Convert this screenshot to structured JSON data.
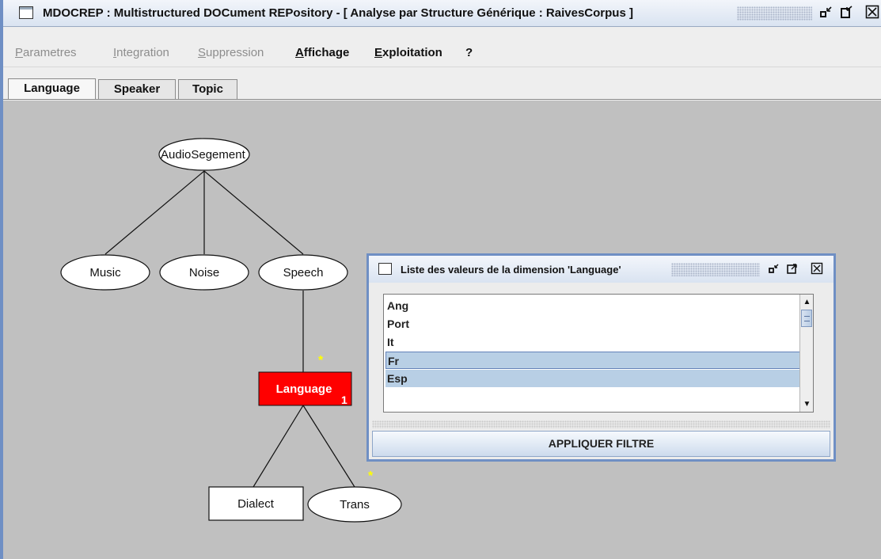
{
  "window": {
    "title": "MDOCREP : Multistructured DOCument REPository - [ Analyse par Structure Générique : RaivesCorpus ]",
    "minimize_icon": "minimize-icon",
    "maximize_icon": "maximize-icon",
    "close_icon": "close-icon"
  },
  "menu": {
    "items": [
      {
        "label": "Parametres",
        "mnemonic": "P",
        "rest": "arametres",
        "enabled": false
      },
      {
        "label": "Integration",
        "mnemonic": "I",
        "rest": "ntegration",
        "enabled": false
      },
      {
        "label": "Suppression",
        "mnemonic": "S",
        "rest": "uppression",
        "enabled": false
      },
      {
        "label": "Affichage",
        "mnemonic": "A",
        "rest": "ffichage",
        "enabled": true
      },
      {
        "label": "Exploitation",
        "mnemonic": "E",
        "rest": "xploitation",
        "enabled": true
      },
      {
        "label": "?",
        "mnemonic": "",
        "rest": "?",
        "enabled": true
      }
    ]
  },
  "tabs": [
    {
      "label": "Language",
      "active": true
    },
    {
      "label": "Speaker",
      "active": false
    },
    {
      "label": "Topic",
      "active": false
    }
  ],
  "tree": {
    "root": "AudioSegement",
    "children": [
      "Music",
      "Noise",
      "Speech"
    ],
    "selected_node": {
      "label": "Language",
      "count": "1",
      "color": "#ff0000"
    },
    "leaves": [
      "Dialect",
      "Trans"
    ],
    "marker": "*",
    "marker_color": "#ffff00"
  },
  "dialog": {
    "title": "Liste des valeurs de la dimension 'Language'",
    "items": [
      "Ang",
      "Port",
      "It",
      "Fr",
      "Esp"
    ],
    "selected": [
      "Fr",
      "Esp"
    ],
    "focused": "Fr",
    "apply_label": "APPLIQUER FILTRE"
  },
  "colors": {
    "canvas_bg": "#c0c0c0",
    "frame_border": "#6f8fc4",
    "selection": "#b8cfe5"
  }
}
